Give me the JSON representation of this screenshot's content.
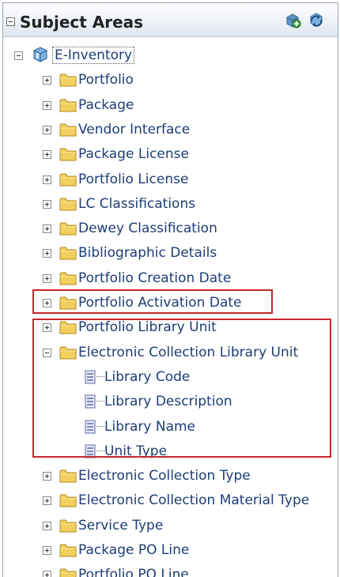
{
  "panel": {
    "title": "Subject Areas",
    "buttons": [
      {
        "name": "add-subject-area-button",
        "icon": "add-cube-icon"
      },
      {
        "name": "refresh-button",
        "icon": "refresh-icon"
      }
    ]
  },
  "tree": {
    "root": {
      "label": "E-Inventory",
      "expanded": true,
      "icon": "cube-icon"
    },
    "folders_top": [
      {
        "label": "Portfolio"
      },
      {
        "label": "Package"
      },
      {
        "label": "Vendor Interface"
      },
      {
        "label": "Package License"
      },
      {
        "label": "Portfolio License"
      },
      {
        "label": "LC Classifications"
      },
      {
        "label": "Dewey Classification"
      },
      {
        "label": "Bibliographic Details"
      },
      {
        "label": "Portfolio Creation Date"
      },
      {
        "label": "Portfolio Activation Date"
      },
      {
        "label": "Portfolio Library Unit"
      }
    ],
    "expanded_folder": {
      "label": "Electronic Collection Library Unit",
      "children": [
        {
          "label": "Library Code"
        },
        {
          "label": "Library Description"
        },
        {
          "label": "Library Name"
        },
        {
          "label": "Unit Type"
        }
      ]
    },
    "folders_bottom": [
      {
        "label": "Electronic Collection Type"
      },
      {
        "label": "Electronic Collection Material Type"
      },
      {
        "label": "Service Type"
      },
      {
        "label": "Package PO Line"
      },
      {
        "label": "Portfolio PO Line"
      }
    ]
  },
  "colors": {
    "highlight": "#c8262c",
    "link_text": "#1d3d75",
    "folder": "#f2cf5e"
  }
}
